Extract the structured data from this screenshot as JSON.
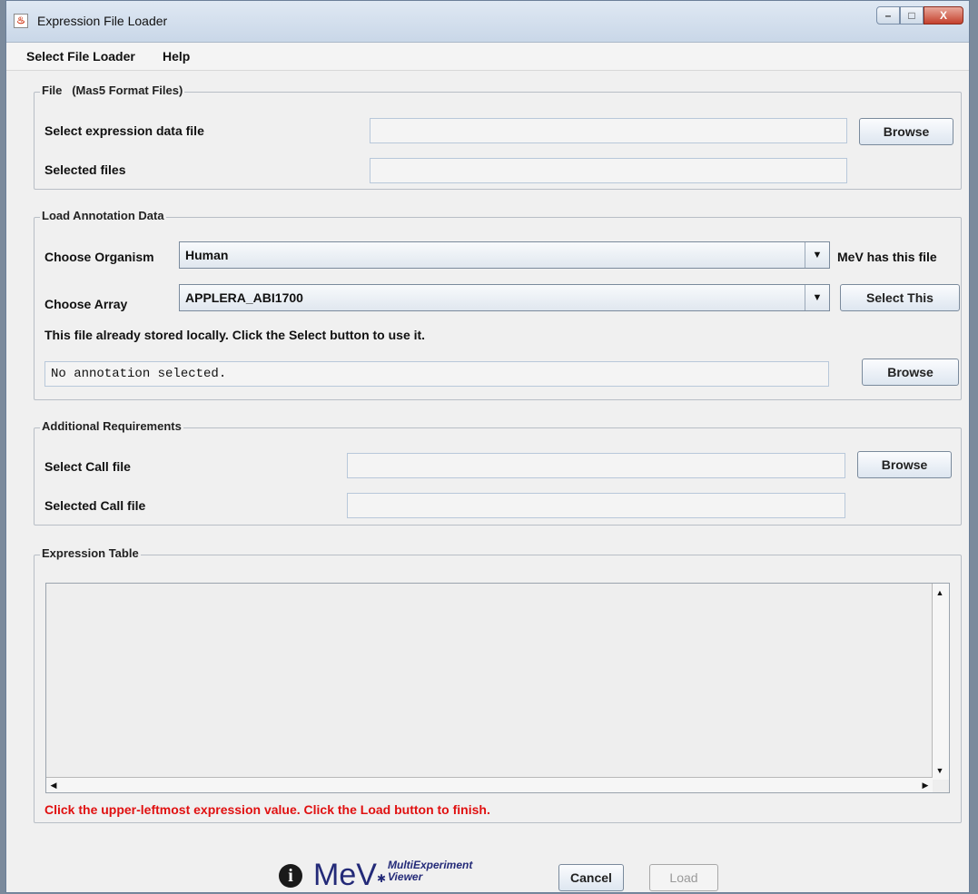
{
  "window": {
    "title": "Expression File Loader",
    "controls": {
      "minimize": "–",
      "maximize": "□",
      "close": "X"
    }
  },
  "menu": {
    "items": [
      "Select File Loader",
      "Help"
    ]
  },
  "file_group": {
    "legend": "File   (Mas5 Format Files)",
    "expression_label": "Select expression data file",
    "expression_value": "",
    "selected_label": "Selected files",
    "selected_value": "",
    "browse_label": "Browse"
  },
  "annotation_group": {
    "legend": "Load Annotation Data",
    "organism_label": "Choose Organism",
    "organism_value": "Human",
    "organism_status": "MeV has this file",
    "array_label": "Choose Array",
    "array_value": "APPLERA_ABI1700",
    "select_this_label": "Select This",
    "stored_message": "This file already stored locally. Click the Select button to use it.",
    "annotation_value": "No annotation selected.",
    "browse_label": "Browse"
  },
  "additional_group": {
    "legend": "Additional Requirements",
    "call_label": "Select Call file",
    "call_value": "",
    "selected_call_label": "Selected Call file",
    "selected_call_value": "",
    "browse_label": "Browse"
  },
  "expression_table": {
    "legend": "Expression Table",
    "hint": "Click the upper-leftmost expression value. Click the Load button to finish."
  },
  "footer": {
    "logo_main": "MeV",
    "logo_sub_1": "MultiExperiment",
    "logo_sub_2": "Viewer",
    "cancel_label": "Cancel",
    "load_label": "Load"
  },
  "colors": {
    "hint": "#e01010",
    "logo": "#232a78"
  }
}
